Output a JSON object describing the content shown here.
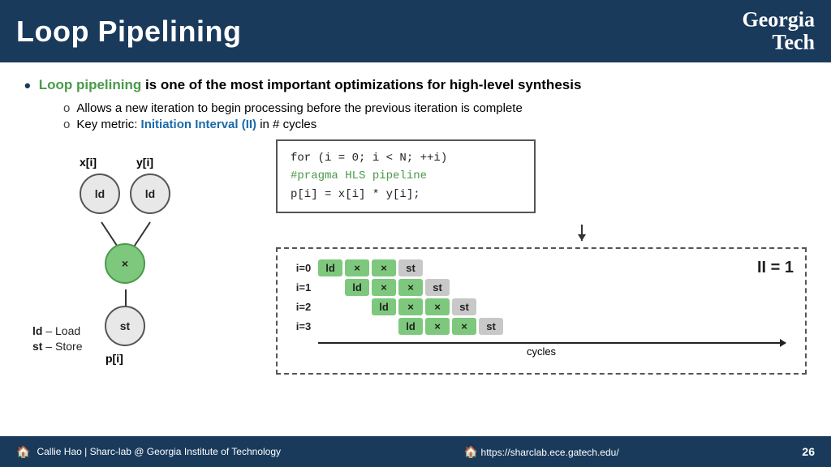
{
  "header": {
    "title": "Loop Pipelining",
    "logo_line1": "Georgia",
    "logo_line2": "Tech"
  },
  "bullets": {
    "main_prefix": "Loop pipelining",
    "main_text": " is one of the most important optimizations for high-level synthesis",
    "sub1": "Allows a new iteration to begin processing before the previous iteration is complete",
    "sub2_prefix": "Key metric: ",
    "sub2_highlight": "Initiation Interval (II)",
    "sub2_suffix": " in # cycles"
  },
  "code": {
    "line1": "for (i = 0; i < N; ++i)",
    "line2": "#pragma HLS pipeline",
    "line3": "    p[i] = x[i] * y[i];"
  },
  "diagram": {
    "label_x": "x[i]",
    "label_y": "y[i]",
    "node_ld1": "ld",
    "node_ld2": "ld",
    "node_mul": "×",
    "node_st": "st",
    "label_p": "p[i]",
    "legend_ld": "ld – Load",
    "legend_st": "st – Store"
  },
  "pipeline": {
    "ii_label": "II = 1",
    "rows": [
      {
        "iter": "i=0",
        "cells": [
          "ld",
          "×",
          "×",
          "st",
          "",
          "",
          "",
          ""
        ]
      },
      {
        "iter": "i=1",
        "cells": [
          "",
          "ld",
          "×",
          "×",
          "st",
          "",
          "",
          ""
        ]
      },
      {
        "iter": "i=2",
        "cells": [
          "",
          "",
          "ld",
          "×",
          "×",
          "st",
          "",
          ""
        ]
      },
      {
        "iter": "i=3",
        "cells": [
          "",
          "",
          "",
          "ld",
          "×",
          "×",
          "st",
          ""
        ]
      }
    ],
    "cycles_label": "cycles"
  },
  "footer": {
    "left_text": "Callie Hao | Sharc-lab @ Georgia Institute of Technology",
    "url": "https://sharclab.ece.gatech.edu/",
    "page_number": "26"
  }
}
